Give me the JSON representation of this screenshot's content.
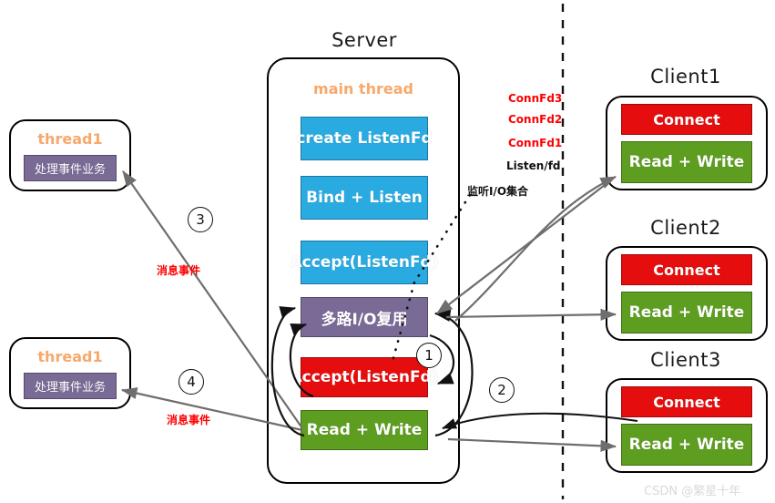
{
  "diagram": {
    "title_server": "Server",
    "watermark": "CSDN @繁星十年"
  },
  "server": {
    "title": "Server",
    "thread_label": "main thread",
    "steps": [
      {
        "label": "create ListenFd",
        "color": "#29ABE2"
      },
      {
        "label": "Bind + Listen",
        "color": "#29ABE2"
      },
      {
        "label": "Accept(ListenFd)",
        "color": "#29ABE2"
      },
      {
        "label": "多路I/O复用",
        "color": "#7A6A96"
      },
      {
        "label": "Accept(ListenFd)",
        "color": "#E50D0D"
      },
      {
        "label": "Read + Write",
        "color": "#5D9E20"
      }
    ]
  },
  "threads": [
    {
      "title": "thread1",
      "task": "处理事件业务",
      "color": "#7A6A96"
    },
    {
      "title": "thread1",
      "task": "处理事件业务",
      "color": "#7A6A96"
    }
  ],
  "clients": [
    {
      "title": "Client1",
      "connect_label": "Connect",
      "rw_label": "Read + Write",
      "connect_color": "#E50D0D",
      "rw_color": "#5D9E20"
    },
    {
      "title": "Client2",
      "connect_label": "Connect",
      "rw_label": "Read + Write",
      "connect_color": "#E50D0D",
      "rw_color": "#5D9E20"
    },
    {
      "title": "Client3",
      "connect_label": "Connect",
      "rw_label": "Read + Write",
      "connect_color": "#E50D0D",
      "rw_color": "#5D9E20"
    }
  ],
  "fd_set": {
    "items": [
      {
        "label": "ConnFd3",
        "color": "#FF0000"
      },
      {
        "label": "ConnFd2",
        "color": "#FF0000"
      },
      {
        "label": "ConnFd1",
        "color": "#FF0000"
      },
      {
        "label": "Listen/fd",
        "color": "#111111"
      }
    ],
    "caption": "监听I/O集合"
  },
  "markers": {
    "one": "1",
    "two": "2",
    "three": "3",
    "four": "4"
  },
  "edge_labels": {
    "msg_event_top": "消息事件",
    "msg_event_bottom": "消息事件"
  }
}
